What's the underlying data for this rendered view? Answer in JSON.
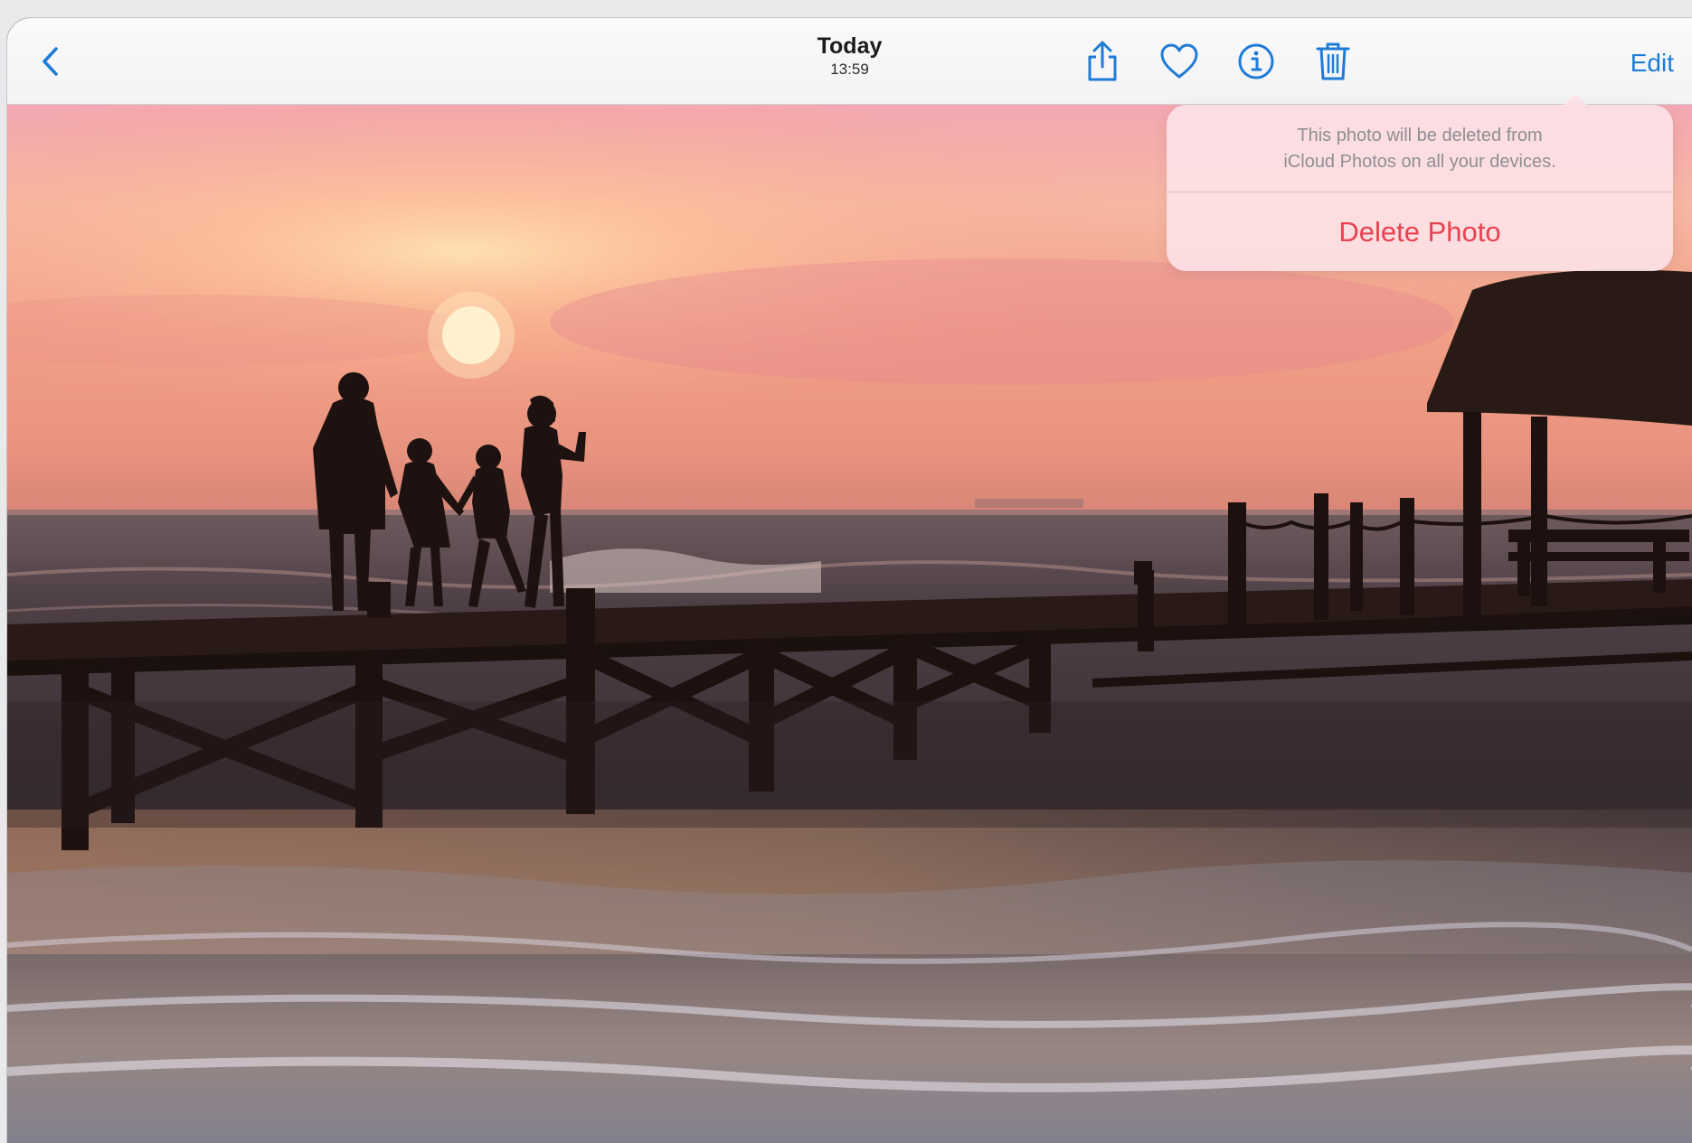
{
  "header": {
    "title": "Today",
    "subtitle": "13:59",
    "edit_label": "Edit"
  },
  "toolbar_icons": [
    "back-icon",
    "share-icon",
    "heart-icon",
    "info-icon",
    "trash-icon"
  ],
  "popover": {
    "message_line1": "This photo will be deleted from",
    "message_line2": "iCloud Photos on all your devices.",
    "delete_label": "Delete Photo"
  },
  "colors": {
    "accent": "#1e7bd8",
    "destructive": "#e8414f"
  }
}
